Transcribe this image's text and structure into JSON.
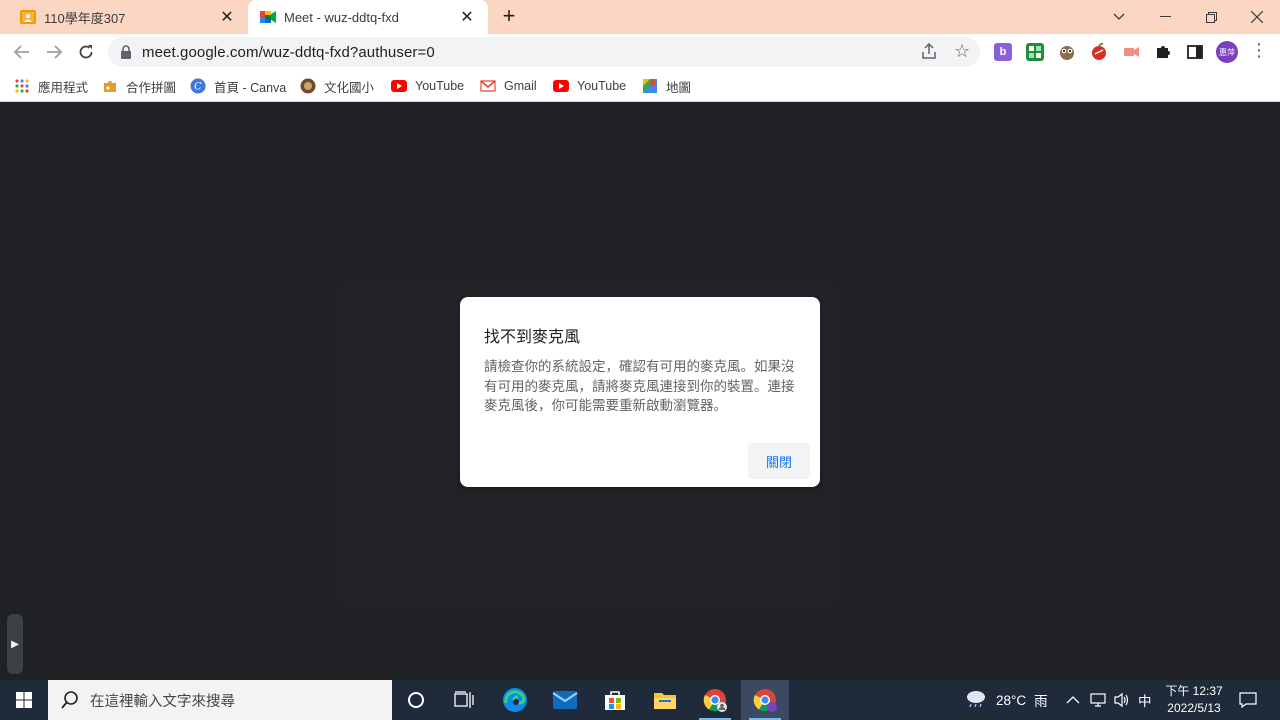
{
  "tabs": [
    {
      "title": "110學年度307",
      "icon": "google-classroom-icon"
    },
    {
      "title": "Meet - wuz-ddtq-fxd",
      "icon": "google-meet-icon"
    }
  ],
  "url": "meet.google.com/wuz-ddtq-fxd?authuser=0",
  "profile_initials": "惠萍",
  "bookmarks": [
    {
      "label": "應用程式",
      "icon": "apps-grid-icon"
    },
    {
      "label": "合作拼圖",
      "icon": "puzzle-bookmark-icon"
    },
    {
      "label": "首頁 - Canva",
      "icon": "canva-icon"
    },
    {
      "label": "文化國小",
      "icon": "school-icon"
    },
    {
      "label": "YouTube",
      "icon": "youtube-icon"
    },
    {
      "label": "Gmail",
      "icon": "gmail-icon"
    },
    {
      "label": "YouTube",
      "icon": "youtube-icon"
    },
    {
      "label": "地圖",
      "icon": "maps-icon"
    }
  ],
  "dialog": {
    "title": "找不到麥克風",
    "body": "請檢查你的系統設定，確認有可用的麥克風。如果沒有可用的麥克風，請將麥克風連接到你的裝置。連接麥克風後，你可能需要重新啟動瀏覽器。",
    "close_label": "關閉"
  },
  "taskbar": {
    "search_placeholder": "在這裡輸入文字來搜尋",
    "weather": "28°C",
    "weather_desc": "雨",
    "ime": "中",
    "time": "下午 12:37",
    "date": "2022/5/13"
  },
  "colors": {
    "tabstrip_bg": "#fbd6c2",
    "content_bg": "#202124",
    "accent_blue": "#1a73e8",
    "taskbar_bg": "#1f2a3a"
  }
}
